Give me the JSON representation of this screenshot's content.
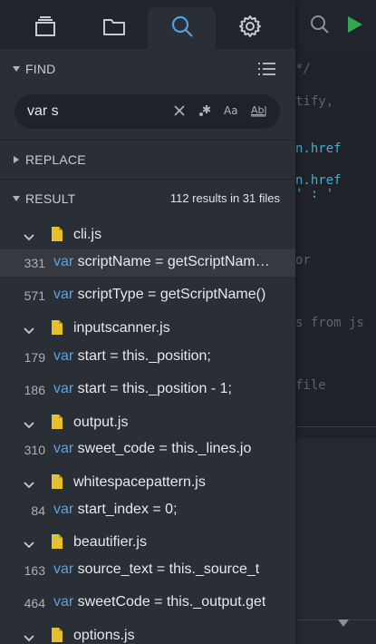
{
  "colors": {
    "accent": "#4aa3e6",
    "file_icon": "#e6c12f",
    "keyword": "#5aa2e3"
  },
  "editor": {
    "code_lines": [
      {
        "text": "*/",
        "color": "gray"
      },
      {
        "text": "tify,",
        "color": "gray"
      },
      {
        "text": "n.href",
        "color": "blue"
      },
      {
        "text": "n.href",
        "color": "blue"
      },
      {
        "text": "' : '",
        "color": "blue"
      },
      {
        "text": "or",
        "color": "gray"
      },
      {
        "text": "s from js",
        "color": "gray"
      },
      {
        "text": "file",
        "color": "gray"
      }
    ]
  },
  "tabs": [
    {
      "icon": "layers-icon"
    },
    {
      "icon": "folder-icon"
    },
    {
      "icon": "search-icon",
      "active": true
    },
    {
      "icon": "gear-icon"
    }
  ],
  "find": {
    "title": "FIND",
    "query": "var s"
  },
  "replace": {
    "title": "REPLACE"
  },
  "result": {
    "title": "RESULT",
    "summary": "112 results in 31 files",
    "groups": [
      {
        "file": "cli.js",
        "matches": [
          {
            "line": "331",
            "kw": "var",
            "text": " scriptName = getScriptNam…"
          },
          {
            "line": "571",
            "kw": "var",
            "text": " scriptType = getScriptName()"
          }
        ]
      },
      {
        "file": "inputscanner.js",
        "matches": [
          {
            "line": "179",
            "kw": "var",
            "text": " start = this._position;"
          },
          {
            "line": "186",
            "kw": "var",
            "text": " start = this._position - 1;"
          }
        ]
      },
      {
        "file": "output.js",
        "matches": [
          {
            "line": "310",
            "kw": "var",
            "text": " sweet_code = this._lines.jo"
          }
        ]
      },
      {
        "file": "whitespacepattern.js",
        "matches": [
          {
            "line": "84",
            "kw": "var",
            "text": " start_index = 0;"
          }
        ]
      },
      {
        "file": "beautifier.js",
        "matches": [
          {
            "line": "163",
            "kw": "var",
            "text": " source_text = this._source_t"
          },
          {
            "line": "464",
            "kw": "var",
            "text": " sweetCode = this._output.get"
          }
        ]
      },
      {
        "file": "options.js",
        "matches": []
      }
    ]
  }
}
